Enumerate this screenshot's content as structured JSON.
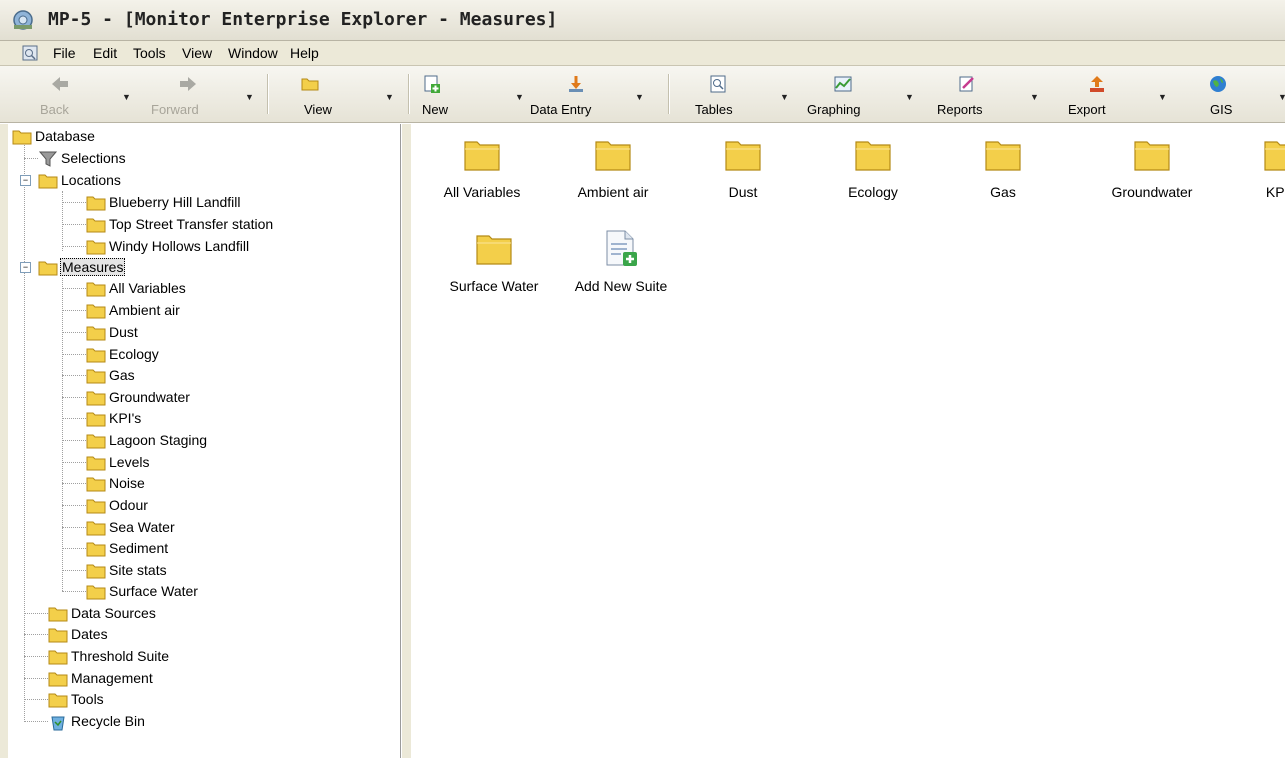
{
  "window": {
    "title": "MP-5 - [Monitor Enterprise Explorer - Measures]"
  },
  "menu": [
    "File",
    "Edit",
    "Tools",
    "View",
    "Window",
    "Help"
  ],
  "toolbar": {
    "back": "Back",
    "forward": "Forward",
    "view": "View",
    "new": "New",
    "data_entry": "Data Entry",
    "tables": "Tables",
    "graphing": "Graphing",
    "reports": "Reports",
    "export": "Export",
    "gis": "GIS"
  },
  "tree": {
    "root": "Database",
    "selections": "Selections",
    "locations": "Locations",
    "location_items": [
      "Blueberry Hill Landfill",
      "Top Street Transfer station",
      "Windy Hollows Landfill"
    ],
    "measures": "Measures",
    "measure_items": [
      "All Variables",
      "Ambient air",
      "Dust",
      "Ecology",
      "Gas",
      "Groundwater",
      "KPI's",
      "Lagoon Staging",
      "Levels",
      "Noise",
      "Odour",
      "Sea Water",
      "Sediment",
      "Site stats",
      "Surface Water"
    ],
    "other_items": [
      "Data Sources",
      "Dates",
      "Threshold Suite",
      "Management",
      "Tools"
    ],
    "recycle_bin": "Recycle Bin"
  },
  "content": {
    "items": [
      "All Variables",
      "Ambient air",
      "Dust",
      "Ecology",
      "Gas",
      "Groundwater",
      "KPI's",
      "Surface Water"
    ],
    "add_new": "Add New Suite"
  }
}
